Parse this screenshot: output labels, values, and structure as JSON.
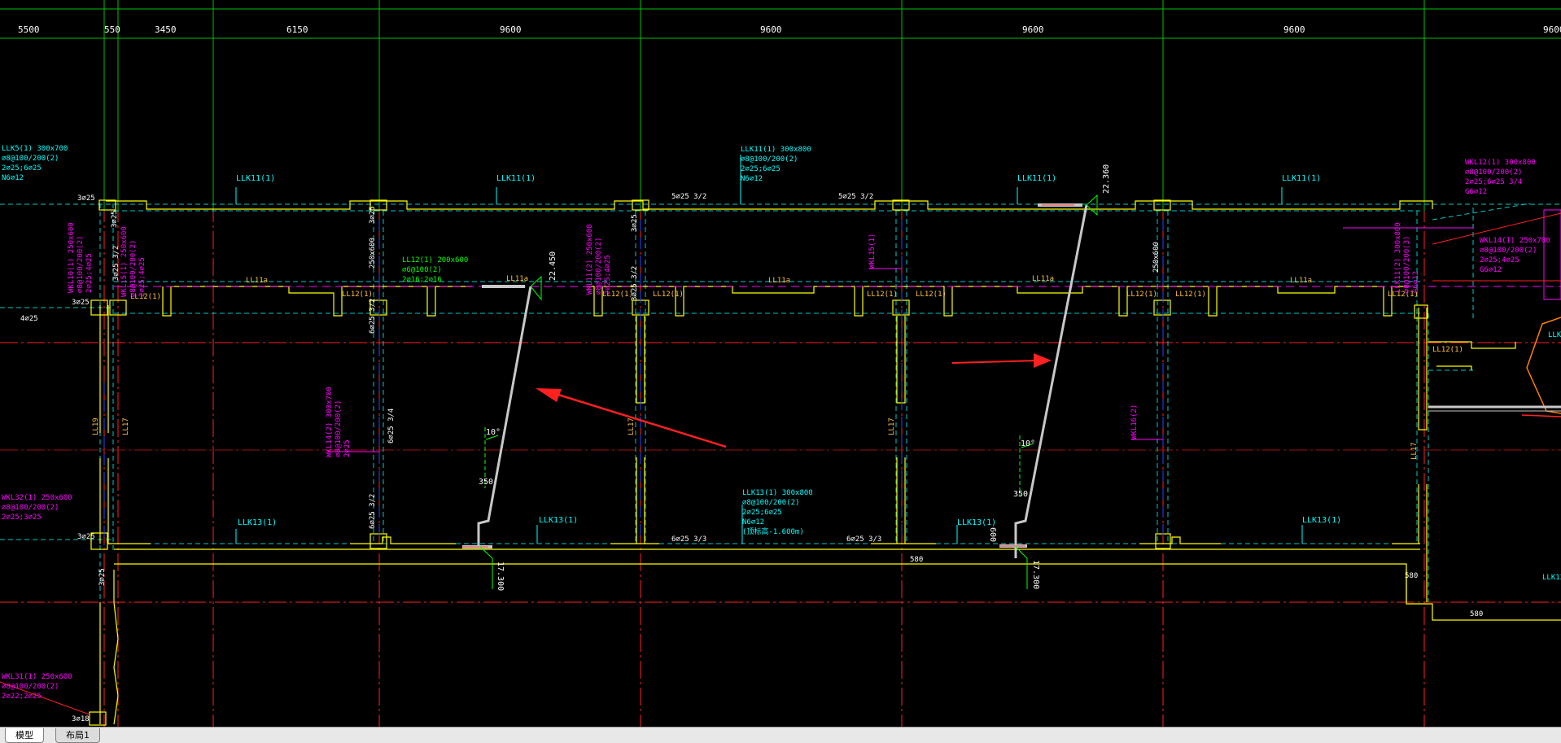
{
  "tabs": {
    "model": "模型",
    "layout1": "布局1"
  },
  "dimensions": {
    "top": [
      "5500",
      "550",
      "3450",
      "6150",
      "9600",
      "9600",
      "9600",
      "9600",
      "9600"
    ]
  },
  "beams": {
    "llk11_a": "LLK11(1)",
    "llk11_b": "LLK11(1)",
    "llk11_c": "LLK11(1)",
    "llk11_d": "LLK11(1)",
    "ll11a_a": "LL11a",
    "ll11a_b": "LL11a",
    "ll11a_c": "LL11a",
    "ll11a_d": "LL11a",
    "ll11a_e": "LL11a",
    "ll12_a": "LL12(1)",
    "ll12_b": "LL12(1)",
    "ll12_c": "LL12(1)",
    "ll12_d": "LL12(1)",
    "ll12_e": "LL12(1)",
    "ll12_f": "LL12(1)",
    "ll12_g": "LL12(1)",
    "ll12_h": "LL12(1)",
    "ll12_i": "LL12(1)",
    "ll12_j": "LL12(1)",
    "ll12_k": "LL12(1)",
    "llk13_a": "LLK13(1)",
    "llk13_b": "LLK13(1)",
    "llk13_c": "LLK13(1)",
    "llk13_d": "LLK13(1)",
    "ll17_a": "LL17",
    "ll17_b": "LL17",
    "ll17_c": "LL17",
    "ll17_d": "LL17",
    "ll17_e": "LL17",
    "ll19": "LL19"
  },
  "rebar": {
    "top_mid1": "5⌀25 3/2",
    "top_mid2": "5⌀25 3/2",
    "bot_mid1": "6⌀25 3/3",
    "bot_mid2": "6⌀25 3/3",
    "c3_25_a": "3⌀25",
    "c3_25_b": "3⌀25",
    "c3_25_c": "3⌀25",
    "c3_25_d": "3⌀25",
    "c4_25": "4⌀25",
    "c3_18": "3⌀18",
    "vert_a": "6⌀25 3/2",
    "vert_b": "6⌀25 3/4",
    "vert_c": "6⌀25 3/2",
    "vert_d": "250x600",
    "vert_e": "250x600",
    "vert_f": "3⌀25 3/2",
    "vert_g": "3⌀25",
    "vert_h": "3⌀25",
    "vert_i": "3⌀25"
  },
  "blocks": {
    "llk5": [
      "LLK5(1) 300x700",
      "⌀8@100/200(2)",
      "2⌀25;6⌀25",
      "N6⌀12"
    ],
    "llk11_top": [
      "LLK11(1) 300x800",
      "⌀8@100/200(2)",
      "2⌀25;6⌀25",
      "N6⌀12"
    ],
    "llk13_bot": [
      "LLK13(1) 300x800",
      "⌀8@100/200(2)",
      "2⌀25;6⌀25",
      "N6⌀12",
      "(顶标高-1.600m)"
    ],
    "ll12_green": [
      "LL12(1) 200x600",
      "⌀6@100(2)",
      "2⌀16;2⌀16"
    ],
    "wkl32": [
      "WKL32(1) 250x600",
      "⌀8@100/200(2)",
      "2⌀25;3⌀25"
    ],
    "wkl31": [
      "WKL31(1) 250x600",
      "⌀8@100/200(2)",
      "2⌀22;2⌀25"
    ],
    "wkl12_r": [
      "WKL12(1) 300x800",
      "⌀8@100/200(2)",
      "2⌀25;6⌀25 3/4",
      "G6⌀12"
    ],
    "wkl14_r": [
      "WKL14(1) 250x700",
      "⌀8@100/200(2)",
      "2⌀25;4⌀25",
      "G6⌀12"
    ],
    "v_mag1": [
      "WKL10(1) 250x600",
      "⌀8@100/200(2)",
      "2⌀25;4⌀25"
    ],
    "v_mag2": [
      "WKL15(1) 250x600",
      "⌀8@100/200(2)",
      "2⌀25;4⌀25"
    ],
    "v_mag3": [
      "WKL14(2) 300x700",
      "⌀8@100/200(2)",
      "2⌀25"
    ],
    "v_mag4": [
      "WKL11(2) 250x600",
      "⌀8@100/200(2)",
      "2⌀25;4⌀25"
    ],
    "v_mag_r": [
      "LLK11(2) 300x800",
      "⌀8@100/200(3)",
      "G6⌀12"
    ]
  },
  "marks": {
    "wkl15": "WKL15(1)",
    "wkl16": "WKL16(2)",
    "ll12_r": "LL12(1)",
    "llk13_r": "LLK13(1)",
    "llk12_r": "LLK12(1)"
  },
  "ramps": {
    "elev1": "22.450",
    "elev2": "22.360",
    "elev3": "17.300",
    "elev4": "17.300",
    "angle1": "10°",
    "angle2": "10°",
    "w1": "350",
    "w2": "350",
    "d1": "600"
  },
  "small_dims": {
    "d580a": "580",
    "d580b": "580",
    "d580c": "580"
  },
  "colors": {
    "grid": "#ff0000",
    "axis": "#00c000",
    "wall": "#ffff00",
    "beam_dash": "#00c8c8",
    "text_cyan": "#00ffff",
    "text_magenta": "#ff00ff",
    "text_green": "#00ff00",
    "ramp": "#c8c8c8",
    "arrow": "#ff2020"
  }
}
